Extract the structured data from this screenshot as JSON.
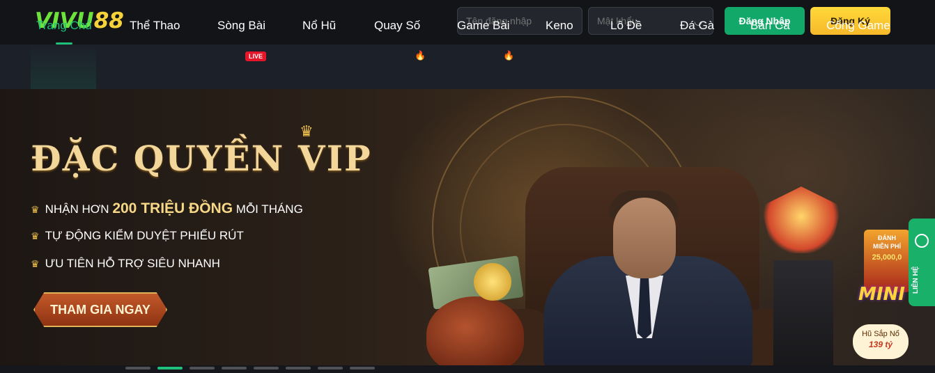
{
  "header": {
    "logo_part1": "VIVU",
    "logo_part2": "88",
    "username_placeholder": "Tên đăng nhập",
    "password_placeholder": "Mật khẩu",
    "login_label": "Đăng Nhập",
    "register_label": "Đăng Ký"
  },
  "nav": {
    "items": [
      {
        "label": "Trang Chủ",
        "active": true
      },
      {
        "label": "Thể Thao"
      },
      {
        "label": "Sòng Bài",
        "badge": "LIVE"
      },
      {
        "label": "Nổ Hũ"
      },
      {
        "label": "Quay Số",
        "hot": true
      },
      {
        "label": "Game Bài",
        "hot": true
      },
      {
        "label": "Keno"
      },
      {
        "label": "Lô Đề"
      },
      {
        "label": "Đá Gà"
      },
      {
        "label": "Bắn Cá"
      },
      {
        "label": "Cổng Game"
      }
    ]
  },
  "banner": {
    "headline": "ĐẶC QUYỀN VIP",
    "perk1_prefix": "NHẬN HƠN",
    "perk1_highlight": "200 TRIỆU ĐỒNG",
    "perk1_suffix": "MỖI THÁNG",
    "perk2": "TỰ ĐỘNG KIỂM DUYỆT PHIẾU RÚT",
    "perk3": "ƯU TIÊN HỖ TRỢ SIÊU NHANH",
    "cta_label": "THAM GIA NGAY"
  },
  "promo_widget": {
    "line1": "ĐÁNH",
    "line2": "MIỄN PHÍ",
    "amount": "25,000,0",
    "mini": "MINI",
    "jackpot_label": "Hũ Sắp Nổ",
    "jackpot_value": "139 tỷ"
  },
  "contact": {
    "label": "LIÊN HỆ"
  },
  "colors": {
    "accent_green": "#1ec07c",
    "register_yellow": "#f6c02e",
    "live_red": "#e5162a"
  }
}
